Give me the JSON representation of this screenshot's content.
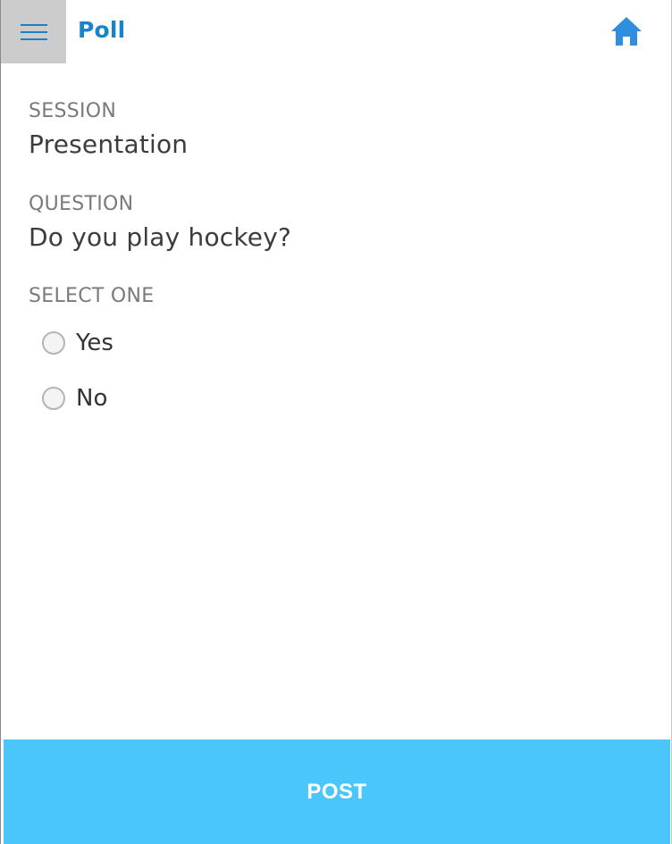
{
  "header": {
    "title": "Poll",
    "menu_icon": "hamburger-menu-icon",
    "home_icon": "home-icon"
  },
  "session": {
    "label": "SESSION",
    "value": "Presentation"
  },
  "question": {
    "label": "QUESTION",
    "value": "Do you play hockey?"
  },
  "options": {
    "label": "SELECT ONE",
    "items": [
      {
        "label": "Yes",
        "selected": false
      },
      {
        "label": "No",
        "selected": false
      }
    ]
  },
  "footer": {
    "post_label": "POST"
  },
  "colors": {
    "accent": "#1783c9",
    "post_button": "#4bc6fb",
    "menu_background": "#cccccc"
  }
}
